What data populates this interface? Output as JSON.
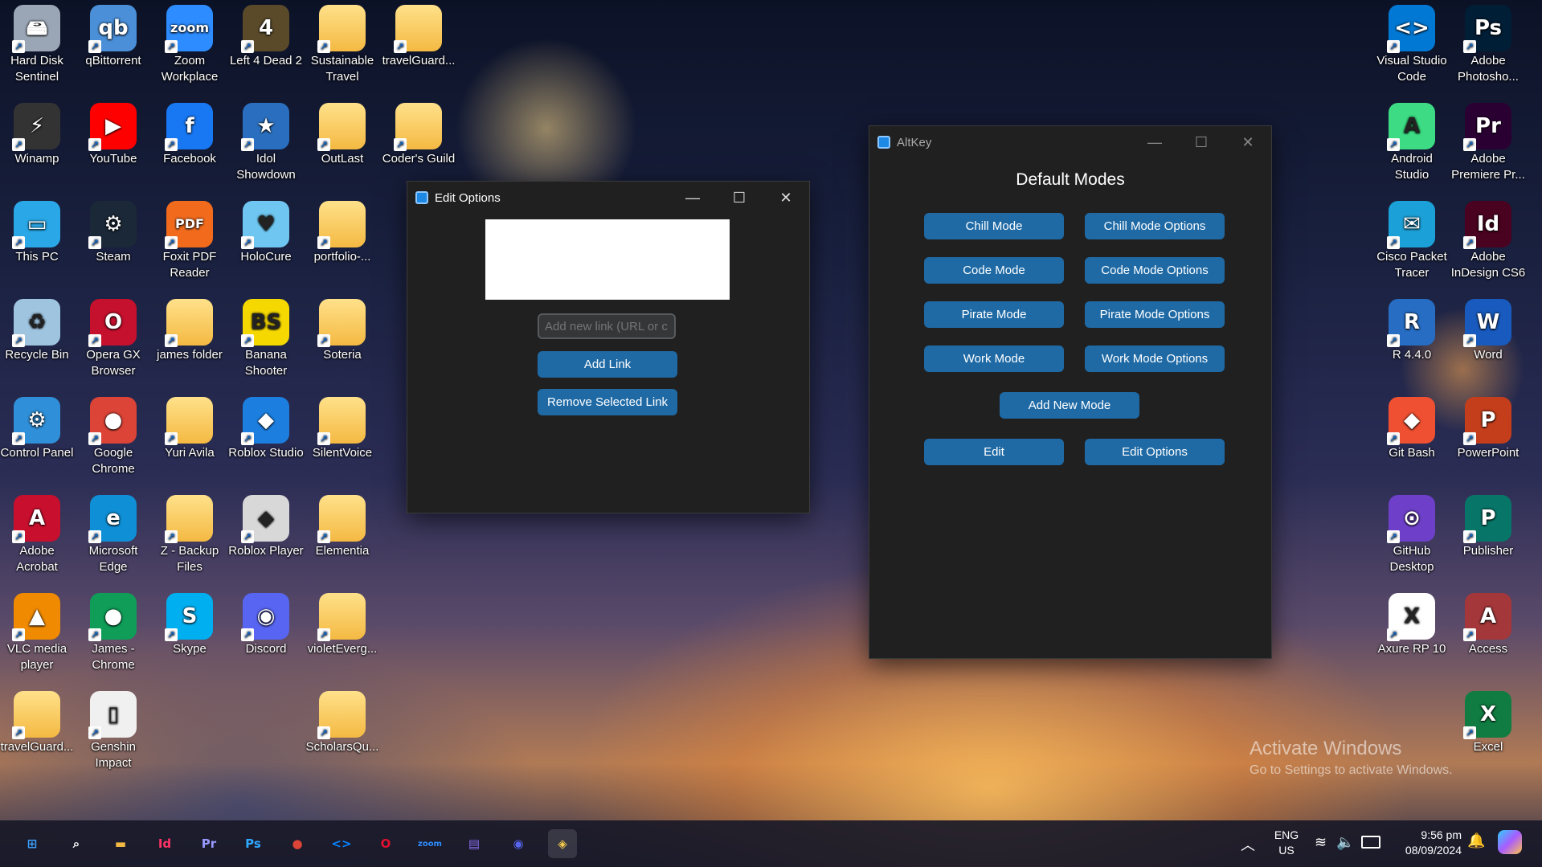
{
  "desktop": {
    "icons": [
      {
        "label": "Hard Disk Sentinel",
        "glyph": "🖴",
        "color": "#9aa6b5"
      },
      {
        "label": "qBittorrent",
        "glyph": "qb",
        "color": "#4a8fd8"
      },
      {
        "label": "Zoom Workplace",
        "glyph": "zoom",
        "color": "#2d8cff"
      },
      {
        "label": "Left 4 Dead 2",
        "glyph": "4",
        "color": "#5a4a2a"
      },
      {
        "label": "Sustainable Travel",
        "glyph": "",
        "color": "folder"
      },
      {
        "label": "travelGuard...",
        "glyph": "",
        "color": "folder"
      },
      {
        "label": "Winamp",
        "glyph": "⚡",
        "color": "#333"
      },
      {
        "label": "YouTube",
        "glyph": "▶",
        "color": "#ff0000"
      },
      {
        "label": "Facebook",
        "glyph": "f",
        "color": "#1877f2"
      },
      {
        "label": "Idol Showdown",
        "glyph": "★",
        "color": "#2a6fbf"
      },
      {
        "label": "OutLast",
        "glyph": "",
        "color": "folder"
      },
      {
        "label": "Coder's Guild",
        "glyph": "",
        "color": "folder"
      },
      {
        "label": "This PC",
        "glyph": "▭",
        "color": "#2aa7e6"
      },
      {
        "label": "Steam",
        "glyph": "⚙",
        "color": "#1b2838"
      },
      {
        "label": "Foxit PDF Reader",
        "glyph": "PDF",
        "color": "#f26b1d"
      },
      {
        "label": "HoloCure",
        "glyph": "♥",
        "color": "#6fc6f0"
      },
      {
        "label": "portfolio-...",
        "glyph": "",
        "color": "folder"
      },
      {
        "label": "Recycle Bin",
        "glyph": "♻",
        "color": "#9fc4e0"
      },
      {
        "label": "Opera GX Browser",
        "glyph": "O",
        "color": "#c5102e"
      },
      {
        "label": "james folder",
        "glyph": "",
        "color": "folder"
      },
      {
        "label": "Banana Shooter",
        "glyph": "BS",
        "color": "#f5d800"
      },
      {
        "label": "Soteria",
        "glyph": "",
        "color": "folder"
      },
      {
        "label": "Control Panel",
        "glyph": "⚙",
        "color": "#2f8fd8"
      },
      {
        "label": "Google Chrome",
        "glyph": "●",
        "color": "#db4437"
      },
      {
        "label": "Yuri Avila",
        "glyph": "",
        "color": "folder"
      },
      {
        "label": "Roblox Studio",
        "glyph": "◆",
        "color": "#1c7fe0"
      },
      {
        "label": "SilentVoice",
        "glyph": "",
        "color": "folder"
      },
      {
        "label": "Adobe Acrobat",
        "glyph": "A",
        "color": "#c8102e"
      },
      {
        "label": "Microsoft Edge",
        "glyph": "e",
        "color": "#0f8fd6"
      },
      {
        "label": "Z - Backup Files",
        "glyph": "",
        "color": "folder"
      },
      {
        "label": "Roblox Player",
        "glyph": "◆",
        "color": "#d8d8d8"
      },
      {
        "label": "Elementia",
        "glyph": "",
        "color": "folder"
      },
      {
        "label": "VLC media player",
        "glyph": "▲",
        "color": "#f08a00"
      },
      {
        "label": "James - Chrome",
        "glyph": "●",
        "color": "#0f9d58"
      },
      {
        "label": "Skype",
        "glyph": "S",
        "color": "#00aff0"
      },
      {
        "label": "Discord",
        "glyph": "◉",
        "color": "#5865f2"
      },
      {
        "label": "violetEverg...",
        "glyph": "",
        "color": "folder"
      },
      {
        "label": "travelGuard...",
        "glyph": "",
        "color": "folder"
      },
      {
        "label": "Genshin Impact",
        "glyph": "▯",
        "color": "#f0f0f0"
      },
      {
        "label": "ScholarsQu...",
        "glyph": "",
        "color": "folder"
      },
      {
        "label": "Visual Studio Code",
        "glyph": "<>",
        "color": "#0078d4"
      },
      {
        "label": "Adobe Photosho...",
        "glyph": "Ps",
        "color": "#001e36"
      },
      {
        "label": "Android Studio",
        "glyph": "A",
        "color": "#3ddc84"
      },
      {
        "label": "Adobe Premiere Pr...",
        "glyph": "Pr",
        "color": "#2a0033"
      },
      {
        "label": "Cisco Packet Tracer",
        "glyph": "✉",
        "color": "#1ba0d7"
      },
      {
        "label": "Adobe InDesign CS6",
        "glyph": "Id",
        "color": "#49021f"
      },
      {
        "label": "R 4.4.0",
        "glyph": "R",
        "color": "#276dc3"
      },
      {
        "label": "Word",
        "glyph": "W",
        "color": "#185abd"
      },
      {
        "label": "Git Bash",
        "glyph": "◆",
        "color": "#f05032"
      },
      {
        "label": "PowerPoint",
        "glyph": "P",
        "color": "#c43e1c"
      },
      {
        "label": "GitHub Desktop",
        "glyph": "⊙",
        "color": "#6e40c9"
      },
      {
        "label": "Publisher",
        "glyph": "P",
        "color": "#077568"
      },
      {
        "label": "Axure RP 10",
        "glyph": "X",
        "color": "#ffffff"
      },
      {
        "label": "Access",
        "glyph": "A",
        "color": "#a4373a"
      },
      {
        "label": "Excel",
        "glyph": "X",
        "color": "#107c41"
      }
    ],
    "watermark": {
      "title": "Activate Windows",
      "subtitle": "Go to Settings to activate Windows."
    }
  },
  "edit_options_window": {
    "title": "Edit Options",
    "link_input_placeholder": "Add new link (URL or c",
    "add_link_label": "Add Link",
    "remove_link_label": "Remove Selected Link"
  },
  "altkey_window": {
    "title": "AltKey",
    "heading": "Default Modes",
    "modes": [
      {
        "mode": "Chill Mode",
        "options": "Chill Mode Options"
      },
      {
        "mode": "Code Mode",
        "options": "Code Mode Options"
      },
      {
        "mode": "Pirate Mode",
        "options": "Pirate Mode Options"
      },
      {
        "mode": "Work Mode",
        "options": "Work Mode Options"
      }
    ],
    "add_new_mode_label": "Add New Mode",
    "edit_label": "Edit",
    "edit_options_label": "Edit Options"
  },
  "taskbar": {
    "apps": [
      {
        "name": "start",
        "glyph": "⊞",
        "color": "#3aa0ff"
      },
      {
        "name": "search",
        "glyph": "⌕",
        "color": "#ffffff"
      },
      {
        "name": "file-explorer",
        "glyph": "▬",
        "color": "#f4b942"
      },
      {
        "name": "indesign",
        "glyph": "Id",
        "color": "#ff3366"
      },
      {
        "name": "premiere",
        "glyph": "Pr",
        "color": "#9999ff"
      },
      {
        "name": "photoshop",
        "glyph": "Ps",
        "color": "#31a8ff"
      },
      {
        "name": "chrome",
        "glyph": "●",
        "color": "#db4437"
      },
      {
        "name": "vscode",
        "glyph": "<>",
        "color": "#0a84ff"
      },
      {
        "name": "opera",
        "glyph": "O",
        "color": "#e0102e"
      },
      {
        "name": "zoom",
        "glyph": "zoom",
        "color": "#2d8cff"
      },
      {
        "name": "clipchamp",
        "glyph": "▤",
        "color": "#8a6cf0"
      },
      {
        "name": "discord",
        "glyph": "◉",
        "color": "#5865f2"
      },
      {
        "name": "python",
        "glyph": "◈",
        "color": "#f2c94c"
      }
    ],
    "tray": {
      "language": "ENG",
      "region": "US",
      "time": "9:56 pm",
      "date": "08/09/2024"
    }
  }
}
